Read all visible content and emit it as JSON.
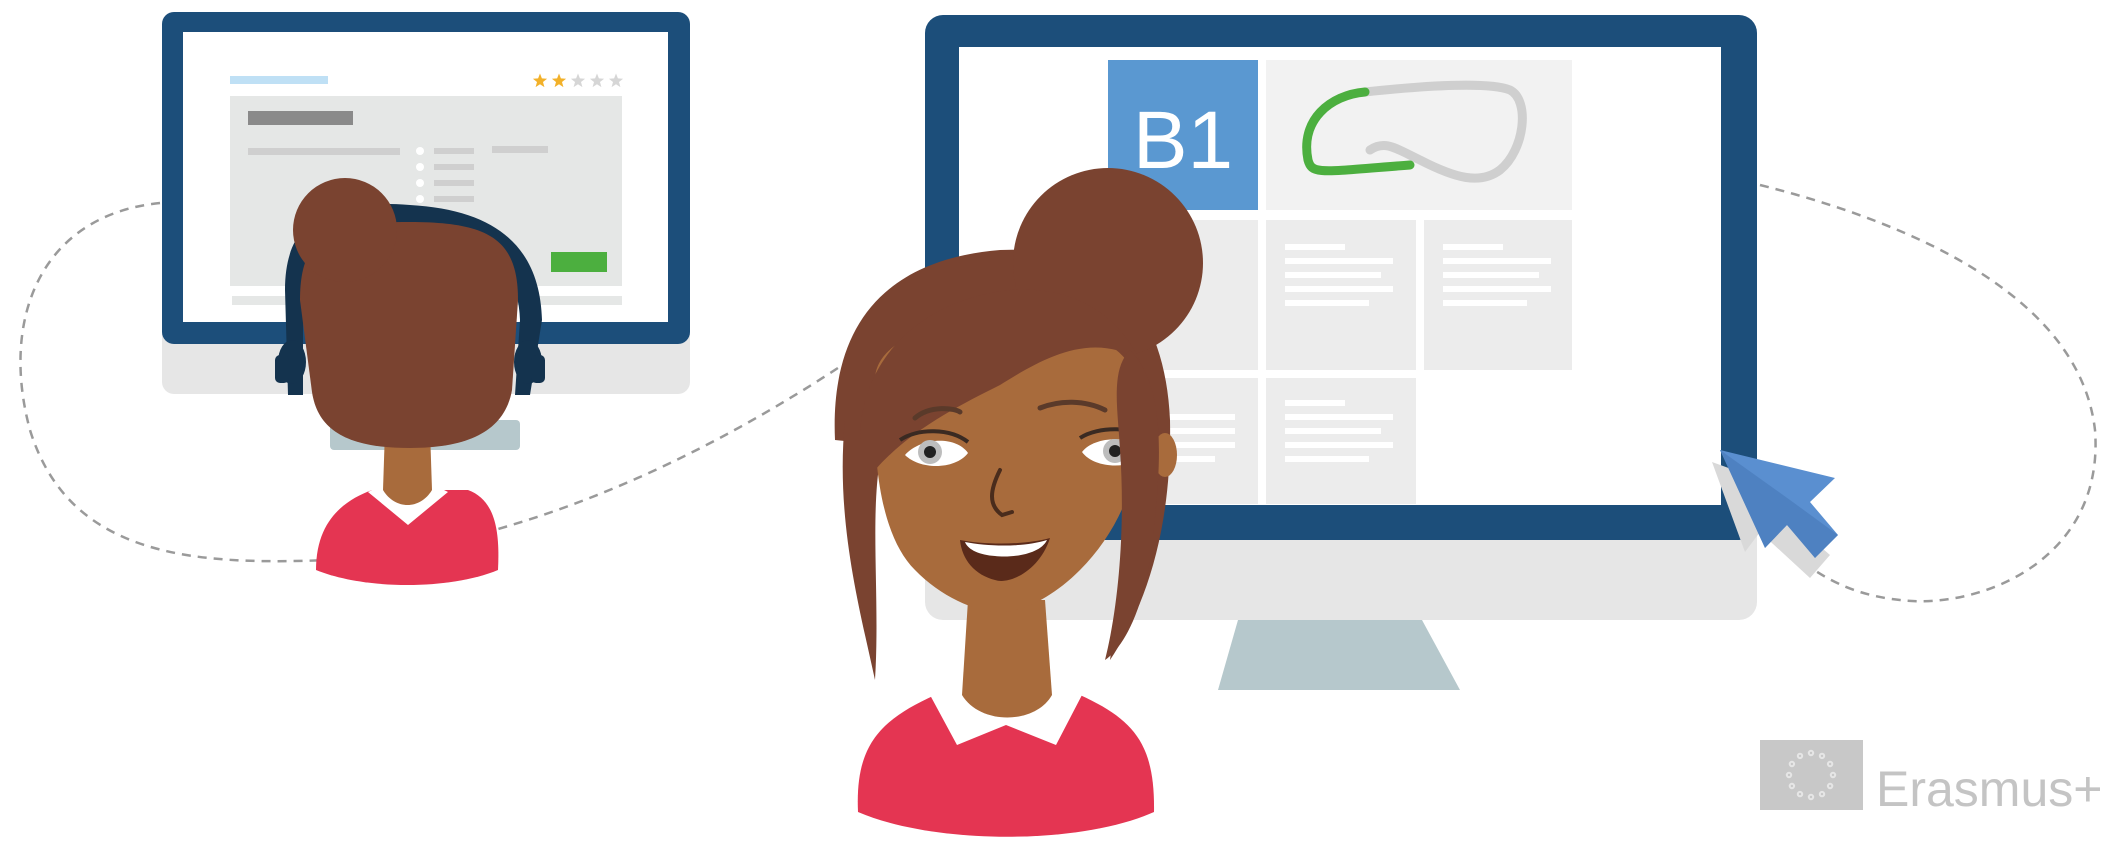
{
  "left_monitor": {
    "rating": {
      "filled": 2,
      "total": 5
    }
  },
  "right_monitor": {
    "level_badge": "B1"
  },
  "logo": {
    "text": "Erasmus+"
  },
  "colors": {
    "monitor_frame": "#1c4e7a",
    "monitor_stand": "#b6c8cc",
    "screen_panel": "#e5e7e6",
    "level_badge": "#5a98d1",
    "green_button": "#4caf3f",
    "star_filled": "#f2b12a",
    "hair": "#7a4330",
    "skin": "#a86b3c",
    "shirt": "#e43552",
    "cursor": "#5a8fd0"
  }
}
